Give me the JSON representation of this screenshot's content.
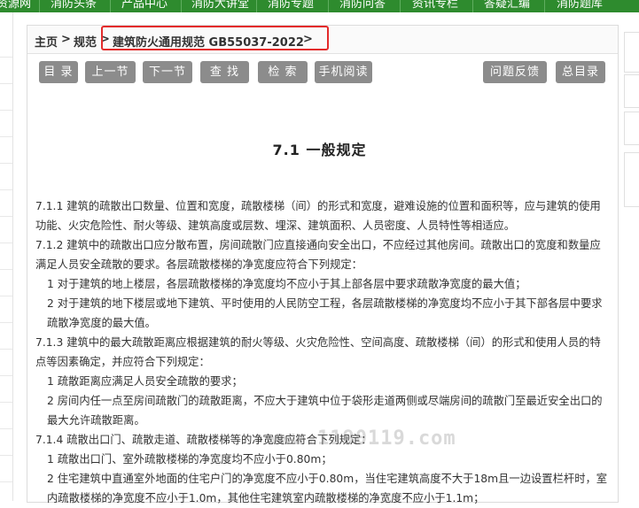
{
  "top_nav": {
    "items": [
      "资源网",
      "消防头条",
      "产品中心",
      "消防大讲堂",
      "消防专题",
      "消防问答",
      "资讯专栏",
      "答疑汇编",
      "消防题库"
    ]
  },
  "breadcrumb": {
    "home": "主页",
    "category": "规范",
    "current": "建筑防火通用规范 GB55037-2022"
  },
  "toolbar": {
    "contents": "目 录",
    "prev": "上一节",
    "next": "下一节",
    "find": "查 找",
    "search": "检 索",
    "mobile": "手机阅读",
    "feedback": "问题反馈",
    "index": "总目录"
  },
  "section": {
    "title": "7.1 一般规定"
  },
  "paragraphs": [
    "7.1.1 建筑的疏散出口数量、位置和宽度，疏散楼梯（间）的形式和宽度，避难设施的位置和面积等，应与建筑的使用功能、火灾危险性、耐火等级、建筑高度或层数、埋深、建筑面积、人员密度、人员特性等相适应。",
    "7.1.2 建筑中的疏散出口应分散布置，房间疏散门应直接通向安全出口，不应经过其他房间。疏散出口的宽度和数量应满足人员安全疏散的要求。各层疏散楼梯的净宽度应符合下列规定：",
    "1 对于建筑的地上楼层，各层疏散楼梯的净宽度均不应小于其上部各层中要求疏散净宽度的最大值；",
    "2 对于建筑的地下楼层或地下建筑、平时使用的人民防空工程，各层疏散楼梯的净宽度均不应小于其下部各层中要求疏散净宽度的最大值。",
    "7.1.3 建筑中的最大疏散距离应根据建筑的耐火等级、火灾危险性、空间高度、疏散楼梯（间）的形式和使用人员的特点等因素确定，并应符合下列规定：",
    "1 疏散距离应满足人员安全疏散的要求；",
    "2 房间内任一点至房间疏散门的疏散距离，不应大于建筑中位于袋形走道两侧或尽端房间的疏散门至最近安全出口的最大允许疏散距离。",
    "7.1.4 疏散出口门、疏散走道、疏散楼梯等的净宽度应符合下列规定：",
    "1 疏散出口门、室外疏散楼梯的净宽度均不应小于0.80m；",
    "2 住宅建筑中直通室外地面的住宅户门的净宽度不应小于0.80m，当住宅建筑高度不大于18m且一边设置栏杆时，室内疏散楼梯的净宽度不应小于1.0m，其他住宅建筑室内疏散楼梯的净宽度不应小于1.1m；"
  ],
  "watermark": "www.1190119.com",
  "colors": {
    "nav_green": "#2e8b2e",
    "button_gray": "#8c8c8c",
    "highlight_red": "#e32b2b"
  }
}
